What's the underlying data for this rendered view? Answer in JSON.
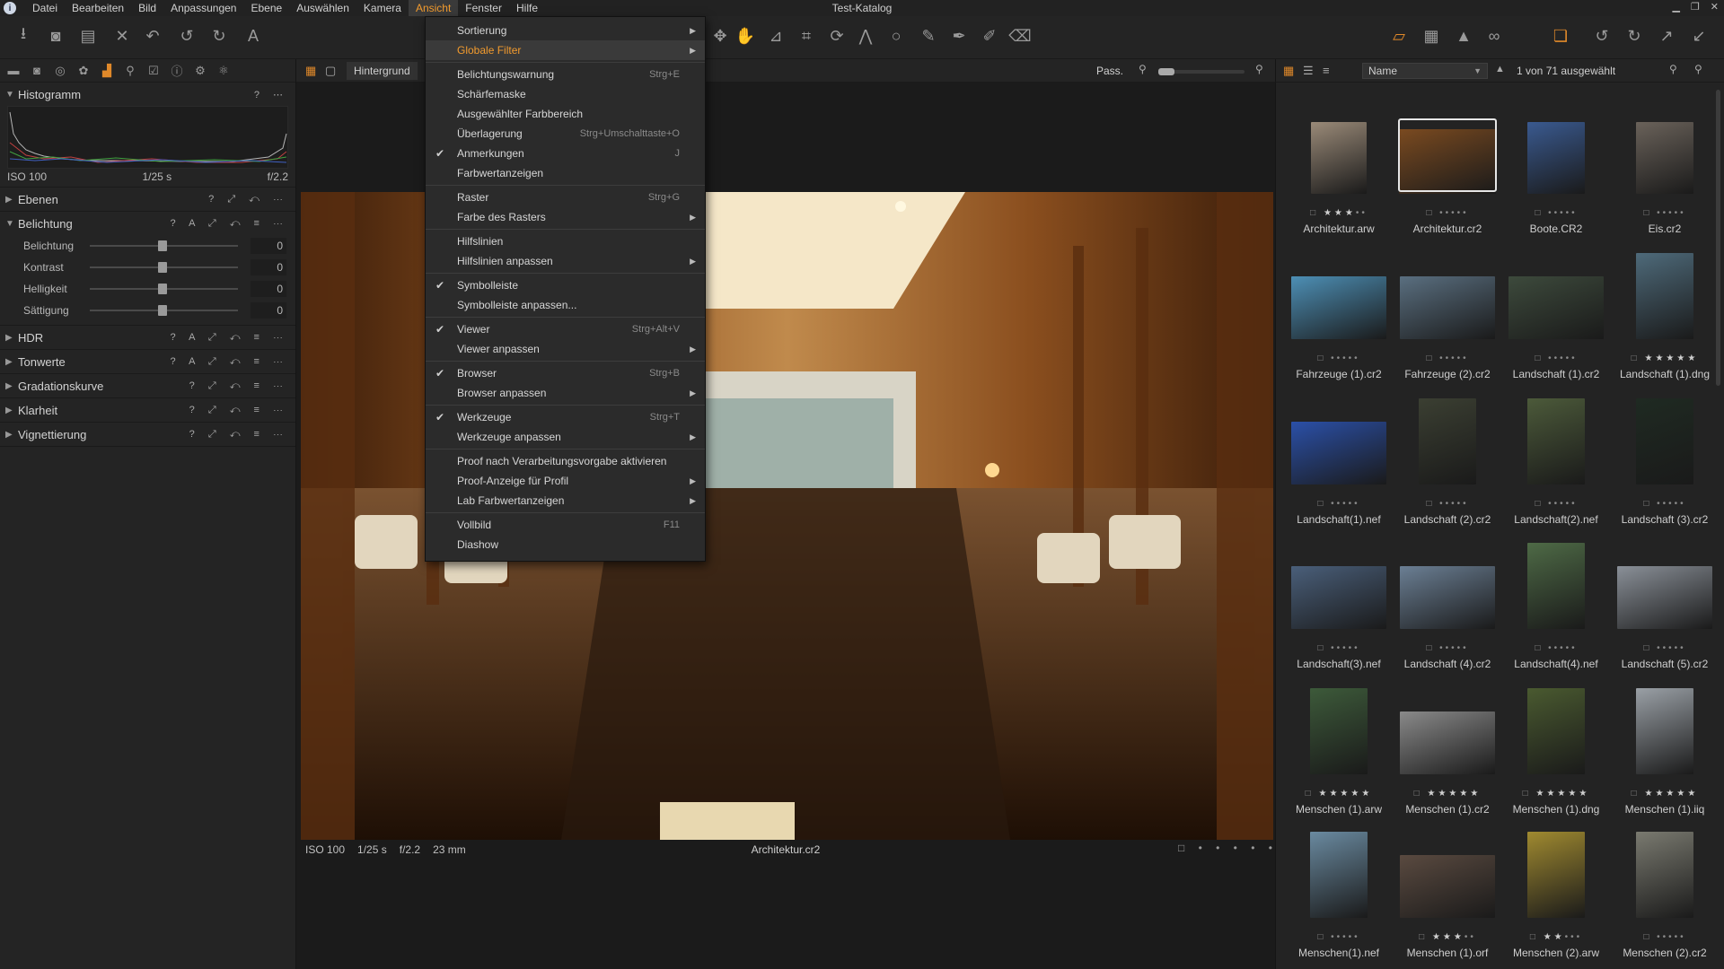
{
  "window": {
    "title": "Test-Katalog"
  },
  "menubar": [
    "Datei",
    "Bearbeiten",
    "Bild",
    "Anpassungen",
    "Ebene",
    "Auswählen",
    "Kamera",
    "Ansicht",
    "Fenster",
    "Hilfe"
  ],
  "active_menu": "Ansicht",
  "dropdown": {
    "items": [
      {
        "label": "Sortierung",
        "shortcut": "",
        "submenu": true,
        "checked": false
      },
      {
        "label": "Globale Filter",
        "shortcut": "",
        "submenu": true,
        "checked": false,
        "highlighted": true
      },
      {
        "sep": true
      },
      {
        "label": "Belichtungswarnung",
        "shortcut": "Strg+E"
      },
      {
        "label": "Schärfemaske",
        "shortcut": ""
      },
      {
        "label": "Ausgewählter Farbbereich",
        "shortcut": ""
      },
      {
        "label": "Überlagerung",
        "shortcut": "Strg+Umschalttaste+O"
      },
      {
        "label": "Anmerkungen",
        "shortcut": "J",
        "checked": true
      },
      {
        "label": "Farbwertanzeigen",
        "shortcut": ""
      },
      {
        "sep": true
      },
      {
        "label": "Raster",
        "shortcut": "Strg+G"
      },
      {
        "label": "Farbe des Rasters",
        "shortcut": "",
        "submenu": true
      },
      {
        "sep": true
      },
      {
        "label": "Hilfslinien",
        "shortcut": ""
      },
      {
        "label": "Hilfslinien anpassen",
        "shortcut": "",
        "submenu": true
      },
      {
        "sep": true
      },
      {
        "label": "Symbolleiste",
        "shortcut": "",
        "checked": true
      },
      {
        "label": "Symbolleiste anpassen...",
        "shortcut": ""
      },
      {
        "sep": true
      },
      {
        "label": "Viewer",
        "shortcut": "Strg+Alt+V",
        "checked": true
      },
      {
        "label": "Viewer anpassen",
        "shortcut": "",
        "submenu": true
      },
      {
        "sep": true
      },
      {
        "label": "Browser",
        "shortcut": "Strg+B",
        "checked": true
      },
      {
        "label": "Browser anpassen",
        "shortcut": "",
        "submenu": true
      },
      {
        "sep": true
      },
      {
        "label": "Werkzeuge",
        "shortcut": "Strg+T",
        "checked": true
      },
      {
        "label": "Werkzeuge anpassen",
        "shortcut": "",
        "submenu": true
      },
      {
        "sep": true
      },
      {
        "label": "Proof nach Verarbeitungsvorgabe aktivieren",
        "shortcut": ""
      },
      {
        "label": "Proof-Anzeige für Profil",
        "shortcut": "",
        "submenu": true
      },
      {
        "label": "Lab Farbwertanzeigen",
        "shortcut": "",
        "submenu": true
      },
      {
        "sep": true
      },
      {
        "label": "Vollbild",
        "shortcut": "F11"
      },
      {
        "label": "Diashow",
        "shortcut": ""
      }
    ]
  },
  "left_panel": {
    "histogram": {
      "title": "Histogramm",
      "iso": "ISO 100",
      "shutter": "1/25 s",
      "aperture": "f/2.2"
    },
    "ebenen": "Ebenen",
    "belichtung": {
      "title": "Belichtung",
      "sliders": [
        {
          "label": "Belichtung",
          "value": "0"
        },
        {
          "label": "Kontrast",
          "value": "0"
        },
        {
          "label": "Helligkeit",
          "value": "0"
        },
        {
          "label": "Sättigung",
          "value": "0"
        }
      ]
    },
    "sections": [
      "HDR",
      "Tonwerte",
      "Gradationskurve",
      "Klarheit",
      "Vignettierung"
    ]
  },
  "viewer": {
    "layer_label": "Hintergrund",
    "zoom_label": "Pass.",
    "meta": {
      "iso": "ISO 100",
      "shutter": "1/25 s",
      "aperture": "f/2.2",
      "focal": "23 mm"
    },
    "filename": "Architektur.cr2"
  },
  "browser": {
    "sort_label": "Name",
    "count_label": "1 von 71 ausgewählt",
    "thumbs": [
      {
        "name": "Architektur.arw",
        "stars": 3,
        "color": "#9a8a78",
        "w": 62,
        "h": 80
      },
      {
        "name": "Architektur.cr2",
        "stars": 0,
        "color": "#7a4a20",
        "w": 108,
        "h": 72,
        "selected": true
      },
      {
        "name": "Boote.CR2",
        "stars": 0,
        "color": "#3a5a90",
        "w": 64,
        "h": 80
      },
      {
        "name": "Eis.cr2",
        "stars": 0,
        "color": "#6a625a",
        "w": 64,
        "h": 80
      },
      {
        "name": "Fahrzeuge (1).cr2",
        "stars": 0,
        "color": "#4d8fb5",
        "w": 106,
        "h": 70
      },
      {
        "name": "Fahrzeuge (2).cr2",
        "stars": 0,
        "color": "#5a6f80",
        "w": 106,
        "h": 70
      },
      {
        "name": "Landschaft (1).cr2",
        "stars": 0,
        "color": "#3d4a3c",
        "w": 106,
        "h": 70
      },
      {
        "name": "Landschaft (1).dng",
        "stars": 5,
        "color": "#4e6a7a",
        "w": 64,
        "h": 96
      },
      {
        "name": "Landschaft(1).nef",
        "stars": 0,
        "color": "#2b50a8",
        "w": 106,
        "h": 70
      },
      {
        "name": "Landschaft (2).cr2",
        "stars": 0,
        "color": "#3b3f32",
        "w": 64,
        "h": 96
      },
      {
        "name": "Landschaft(2).nef",
        "stars": 0,
        "color": "#4c5a3a",
        "w": 64,
        "h": 96
      },
      {
        "name": "Landschaft (3).cr2",
        "stars": 0,
        "color": "#1f2a22",
        "w": 64,
        "h": 96
      },
      {
        "name": "Landschaft(3).nef",
        "stars": 0,
        "color": "#4a5f7a",
        "w": 106,
        "h": 70
      },
      {
        "name": "Landschaft (4).cr2",
        "stars": 0,
        "color": "#6b7f94",
        "w": 106,
        "h": 70
      },
      {
        "name": "Landschaft(4).nef",
        "stars": 0,
        "color": "#4e6a46",
        "w": 64,
        "h": 96
      },
      {
        "name": "Landschaft (5).cr2",
        "stars": 0,
        "color": "#8a9098",
        "w": 106,
        "h": 70
      },
      {
        "name": "Menschen (1).arw",
        "stars": 5,
        "color": "#3d5a3a",
        "w": 64,
        "h": 96
      },
      {
        "name": "Menschen (1).cr2",
        "stars": 5,
        "color": "#8a8a8a",
        "w": 106,
        "h": 70
      },
      {
        "name": "Menschen (1).dng",
        "stars": 5,
        "color": "#4a5a30",
        "w": 64,
        "h": 96
      },
      {
        "name": "Menschen (1).iiq",
        "stars": 5,
        "color": "#9aa0a6",
        "w": 64,
        "h": 96
      },
      {
        "name": "Menschen(1).nef",
        "stars": 0,
        "color": "#6a8aa0",
        "w": 64,
        "h": 96
      },
      {
        "name": "Menschen (1).orf",
        "stars": 3,
        "color": "#5a4a40",
        "w": 106,
        "h": 70
      },
      {
        "name": "Menschen (2).arw",
        "stars": 2,
        "color": "#a08a30",
        "w": 64,
        "h": 96
      },
      {
        "name": "Menschen (2).cr2",
        "stars": 0,
        "color": "#7a7a70",
        "w": 64,
        "h": 96
      }
    ]
  }
}
